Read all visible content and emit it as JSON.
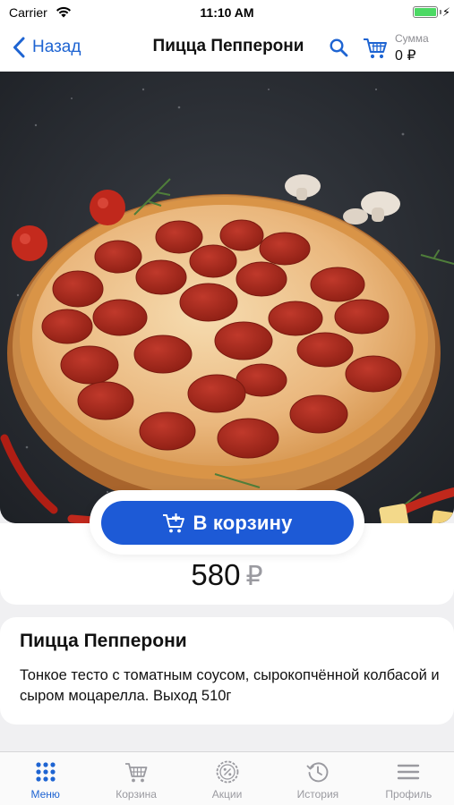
{
  "status": {
    "carrier": "Carrier",
    "time": "11:10 AM",
    "battery_level": 1.0
  },
  "nav": {
    "back_label": "Назад",
    "title": "Пицца Пепперони",
    "sum_label": "Сумма",
    "sum_value": "0 ₽"
  },
  "product": {
    "add_to_cart_label": "В корзину",
    "price": "580",
    "currency": "₽",
    "name": "Пицца Пепперони",
    "description": "Тонкое тесто с томатным соусом, сырокопчённой колбасой и сыром моцарелла. Выход 510г"
  },
  "tabs": [
    {
      "label": "Меню",
      "icon": "grid-icon",
      "active": true
    },
    {
      "label": "Корзина",
      "icon": "cart-icon",
      "active": false
    },
    {
      "label": "Акции",
      "icon": "percent-badge-icon",
      "active": false
    },
    {
      "label": "История",
      "icon": "history-icon",
      "active": false
    },
    {
      "label": "Профиль",
      "icon": "menu-lines-icon",
      "active": false
    }
  ],
  "colors": {
    "accent": "#1e64d2",
    "button": "#1d5ad6",
    "inactive": "#9a9aa0"
  }
}
